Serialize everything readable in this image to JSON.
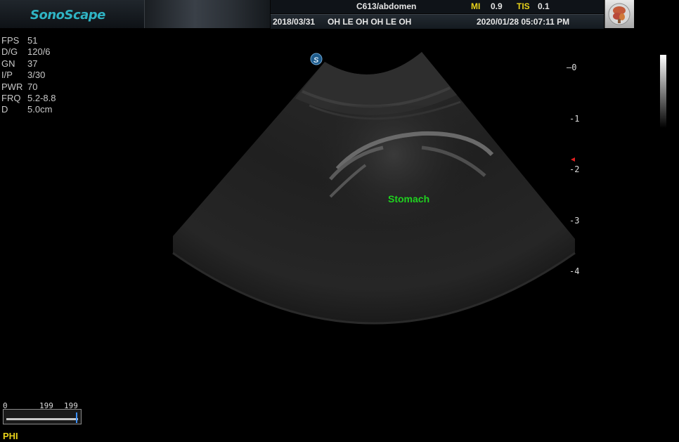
{
  "header": {
    "brand": "SonoScape",
    "probe_preset": "C613/abdomen",
    "mi_label": "MI",
    "mi_value": "0.9",
    "tis_label": "TIS",
    "tis_value": "0.1",
    "study_date": "2018/03/31",
    "hospital": "OH LE OH OH LE OH",
    "datetime": "2020/01/28 05:07:11 PM",
    "organ_icon": "liver-icon"
  },
  "params": [
    {
      "key": "FPS",
      "value": "51"
    },
    {
      "key": "D/G",
      "value": "120/6"
    },
    {
      "key": "GN",
      "value": "37"
    },
    {
      "key": "I/P",
      "value": "3/30"
    },
    {
      "key": "PWR",
      "value": "70"
    },
    {
      "key": "FRQ",
      "value": "5.2-8.8"
    },
    {
      "key": "D",
      "value": "5.0cm"
    }
  ],
  "annotation": "Stomach",
  "depth_scale": [
    "0",
    "1",
    "2",
    "3",
    "4"
  ],
  "cine": {
    "left": "0",
    "mid": "199",
    "right": "199"
  },
  "mode": "PHI",
  "colors": {
    "brand": "#2fb4c4",
    "accent": "#e8d21a",
    "annotation": "#1fd21f",
    "focus": "#e02020"
  }
}
